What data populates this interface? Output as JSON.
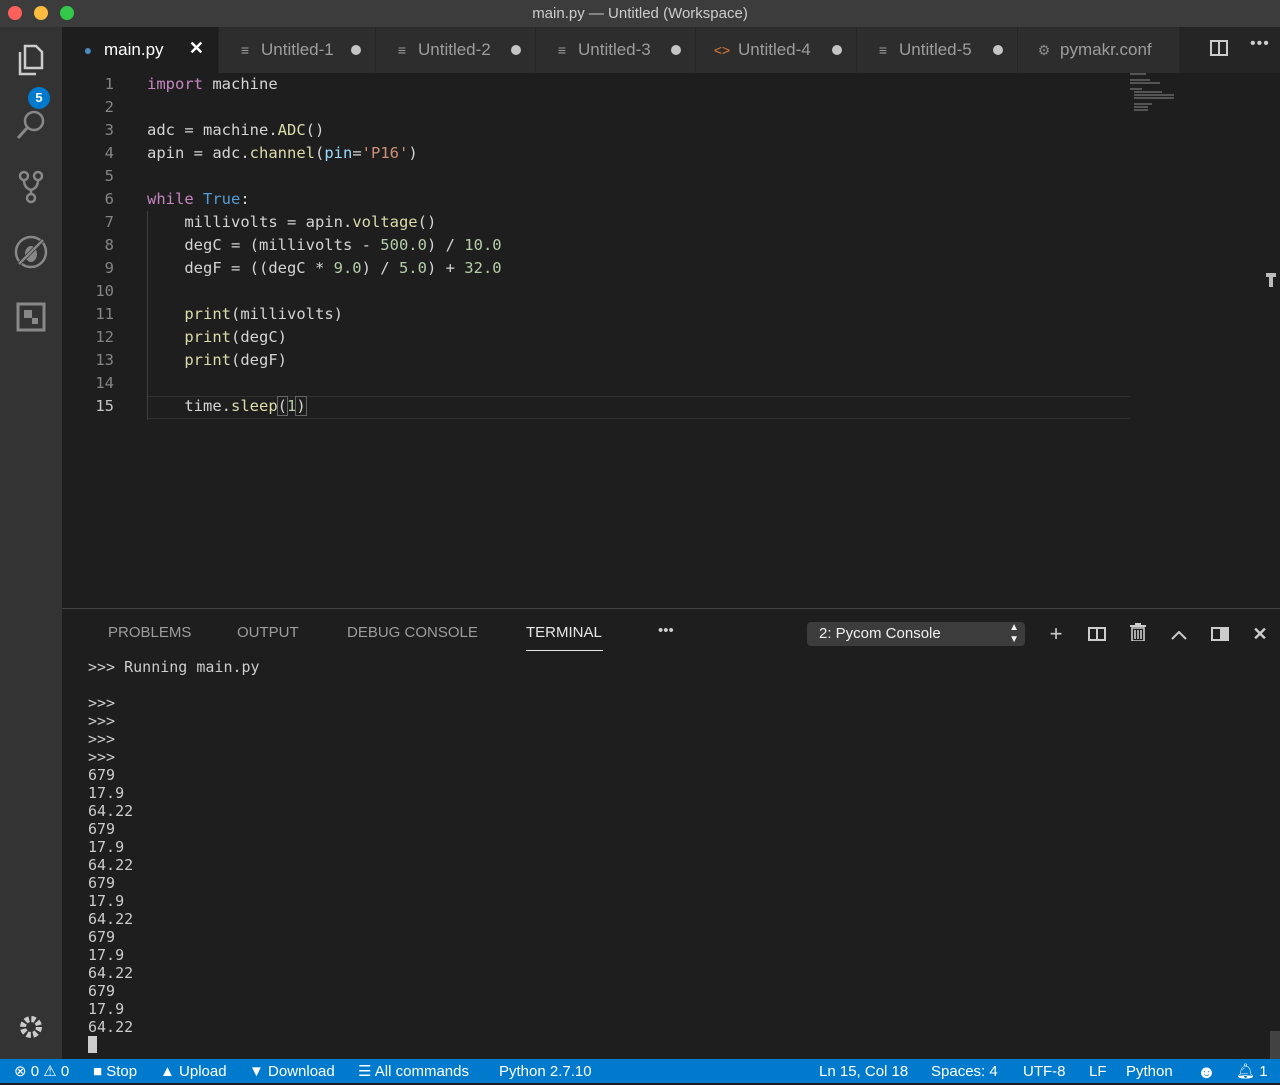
{
  "window": {
    "title": "main.py — Untitled (Workspace)"
  },
  "activity_bar": {
    "explorer_badge": "5",
    "icons": [
      "files-icon",
      "search-icon",
      "source-control-icon",
      "debug-icon",
      "extensions-icon",
      "gear-icon"
    ]
  },
  "tabs": [
    {
      "label": "main.py",
      "icon": "python-file-icon",
      "active": true
    },
    {
      "label": "Untitled-1",
      "icon": "text-file-icon",
      "dirty": true
    },
    {
      "label": "Untitled-2",
      "icon": "text-file-icon",
      "dirty": true
    },
    {
      "label": "Untitled-3",
      "icon": "text-file-icon",
      "dirty": true
    },
    {
      "label": "Untitled-4",
      "icon": "code-file-icon",
      "dirty": true
    },
    {
      "label": "Untitled-5",
      "icon": "text-file-icon",
      "dirty": true
    },
    {
      "label": "pymakr.conf",
      "icon": "settings-file-icon"
    }
  ],
  "editor": {
    "lines": [
      "import machine",
      "",
      "adc = machine.ADC()",
      "apin = adc.channel(pin='P16')",
      "",
      "while True:",
      "    millivolts = apin.voltage()",
      "    degC = (millivolts - 500.0) / 10.0",
      "    degF = ((degC * 9.0) / 5.0) + 32.0",
      "",
      "    print(millivolts)",
      "    print(degC)",
      "    print(degF)",
      "",
      "    time.sleep(1)"
    ]
  },
  "panel": {
    "tabs": [
      "PROBLEMS",
      "OUTPUT",
      "DEBUG CONSOLE",
      "TERMINAL"
    ],
    "active_tab": "TERMINAL",
    "more": "•••",
    "terminal_select": "2: Pycom Console",
    "terminal_lines": [
      ">>> Running main.py",
      "",
      ">>>",
      ">>>",
      ">>>",
      ">>>",
      "679",
      "17.9",
      "64.22",
      "679",
      "17.9",
      "64.22",
      "679",
      "17.9",
      "64.22",
      "679",
      "17.9",
      "64.22",
      "679",
      "17.9",
      "64.22"
    ]
  },
  "status_bar": {
    "errors": "0",
    "warnings": "0",
    "stop": "Stop",
    "upload": "Upload",
    "download": "Download",
    "all_commands": "All commands",
    "python_version": "Python 2.7.10",
    "cursor_pos": "Ln 15, Col 18",
    "spaces": "Spaces: 4",
    "encoding": "UTF-8",
    "eol": "LF",
    "language": "Python",
    "notifications": "1"
  },
  "colors": {
    "accent": "#007acc",
    "activity_bg": "#333333",
    "editor_bg": "#1e1e1e"
  }
}
